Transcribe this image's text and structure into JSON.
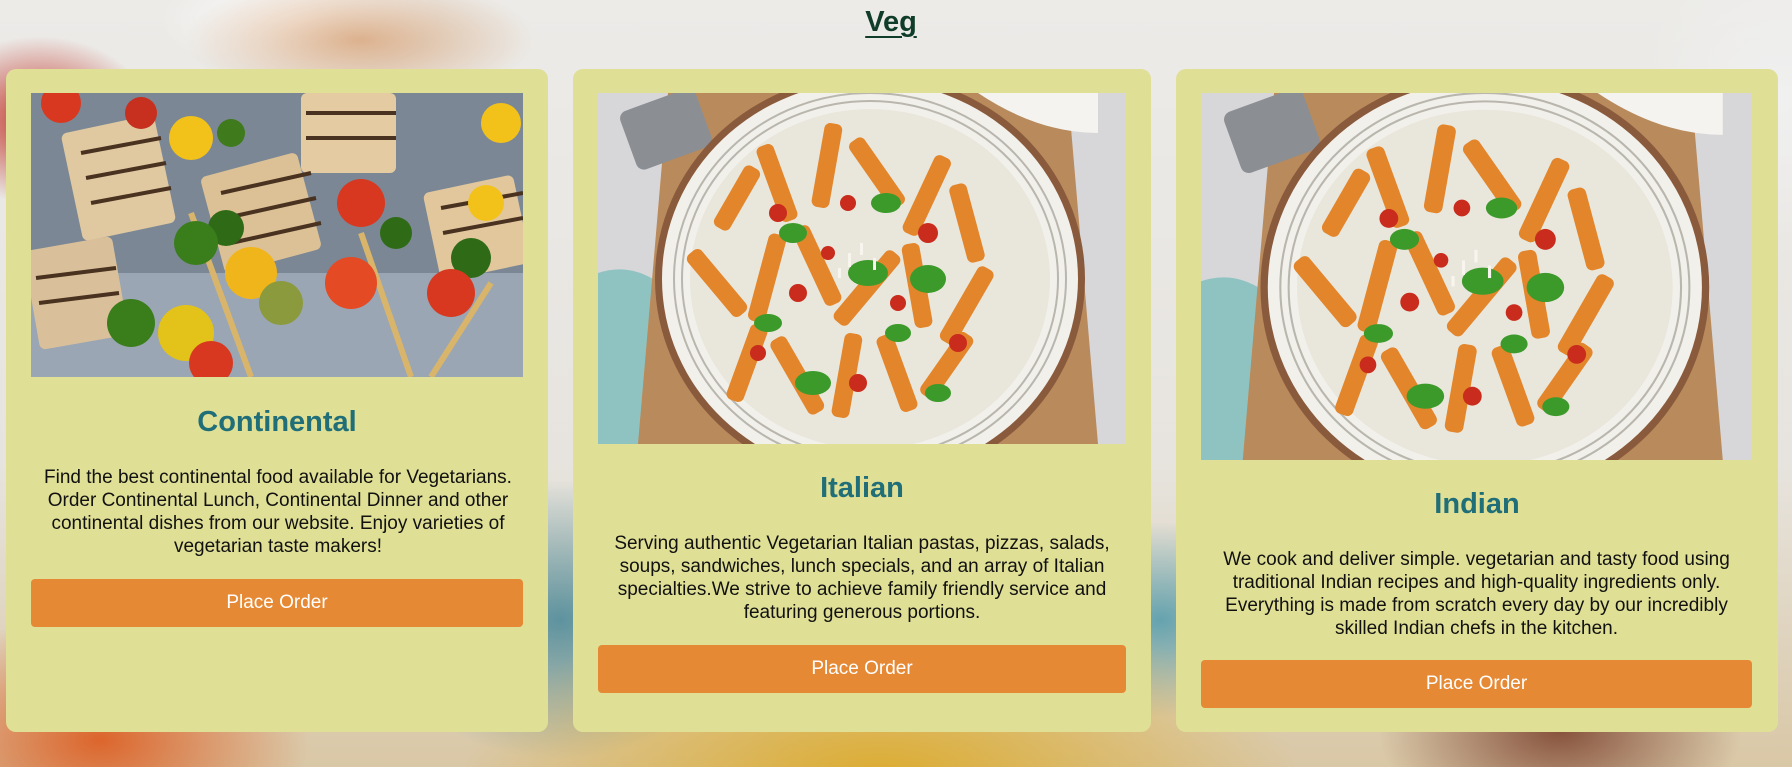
{
  "page": {
    "title": "Veg"
  },
  "colors": {
    "card_background": "#dfdf95",
    "card_title": "#1f6e78",
    "button": "#e68934",
    "button_text": "#ffffff",
    "page_title": "#0f3d2a"
  },
  "cards": [
    {
      "title": "Continental",
      "image_subject": "grilled paneer and vegetable skewers",
      "description": "Find the best continental food available for Vegetarians. Order Continental Lunch, Continental Dinner and other continental dishes from our website. Enjoy varieties of vegetarian taste makers!",
      "button_label": "Place Order"
    },
    {
      "title": "Italian",
      "image_subject": "penne pasta with tomato sauce and basil",
      "description": "Serving authentic Vegetarian Italian pastas, pizzas, salads, soups, sandwiches, lunch specials, and an array of Italian specialties.We strive to achieve family friendly service and featuring generous portions.",
      "button_label": "Place Order"
    },
    {
      "title": "Indian",
      "image_subject": "penne pasta with tomato sauce and basil",
      "description": "We cook and deliver simple. vegetarian and tasty food using traditional Indian recipes and high-quality ingredients only. Everything is made from scratch every day by our incredibly skilled Indian chefs in the kitchen.",
      "button_label": "Place Order"
    }
  ]
}
